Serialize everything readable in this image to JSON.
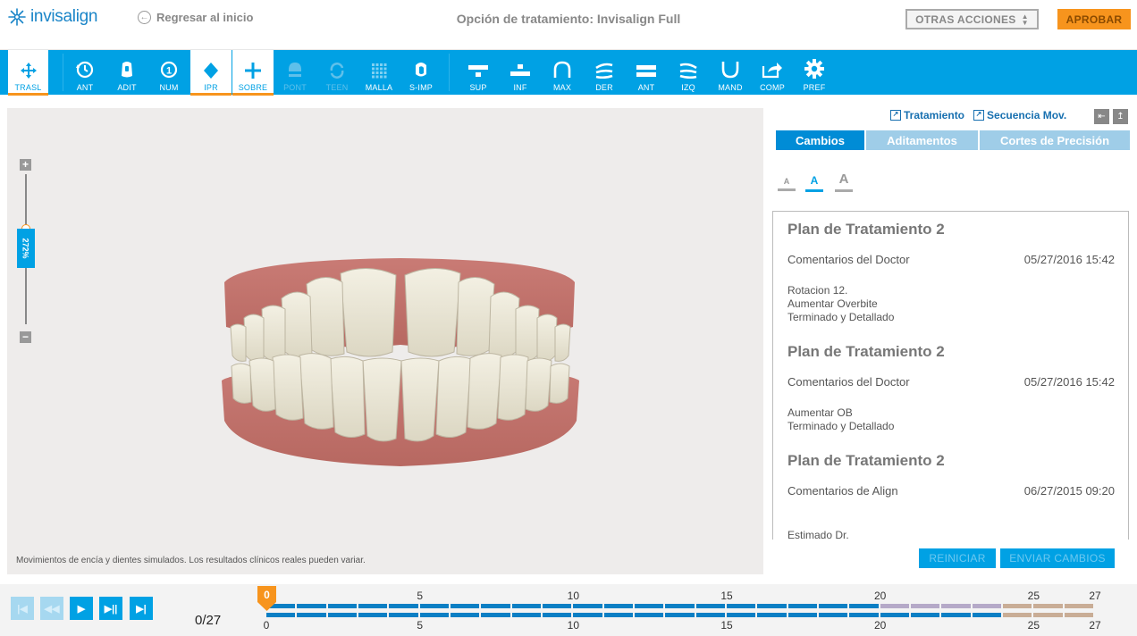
{
  "header": {
    "logo_text": "invisalign",
    "back_label": "Regresar al inicio",
    "title": "Opción de tratamiento: Invisalign Full",
    "other_actions": "OTRAS ACCIONES",
    "approve": "APROBAR"
  },
  "toolbar": {
    "tools": [
      {
        "label": "TRASL",
        "icon": "move-icon"
      },
      {
        "label": "ANT",
        "icon": "history-icon"
      },
      {
        "label": "ADIT",
        "icon": "attachment-icon"
      },
      {
        "label": "NUM",
        "icon": "number-icon"
      },
      {
        "label": "IPR",
        "icon": "diamond-icon"
      },
      {
        "label": "SOBRE",
        "icon": "plus-icon"
      },
      {
        "label": "PONT",
        "icon": "pontic-icon"
      },
      {
        "label": "TEEN",
        "icon": "teen-icon"
      },
      {
        "label": "MALLA",
        "icon": "grid-icon"
      },
      {
        "label": "S-IMP",
        "icon": "superimpose-icon"
      },
      {
        "label": "SUP",
        "icon": "upper-arch-icon"
      },
      {
        "label": "INF",
        "icon": "lower-arch-icon"
      },
      {
        "label": "MAX",
        "icon": "maxillary-icon"
      },
      {
        "label": "DER",
        "icon": "right-view-icon"
      },
      {
        "label": "ANT",
        "icon": "anterior-view-icon"
      },
      {
        "label": "IZQ",
        "icon": "left-view-icon"
      },
      {
        "label": "MAND",
        "icon": "mandibular-icon"
      },
      {
        "label": "COMP",
        "icon": "share-icon"
      },
      {
        "label": "PREF",
        "icon": "gear-icon"
      }
    ]
  },
  "viewport": {
    "zoom_label": "272%",
    "disclaimer": "Movimientos de encía y dientes simulados. Los resultados clínicos reales pueden variar."
  },
  "panel": {
    "link_treatment": "Tratamiento",
    "link_sequence": "Secuencia Mov.",
    "tabs": [
      "Cambios",
      "Aditamentos",
      "Cortes de Precisión"
    ],
    "font_sizes": [
      "A",
      "A",
      "A"
    ],
    "notes": [
      {
        "title": "Plan de Tratamiento 2",
        "author": "Comentarios del Doctor",
        "date": "05/27/2016 15:42",
        "body": "Rotacion 12.\nAumentar Overbite\nTerminado y Detallado"
      },
      {
        "title": "Plan de Tratamiento 2",
        "author": "Comentarios del Doctor",
        "date": "05/27/2016 15:42",
        "body": "Aumentar OB\nTerminado y Detallado"
      },
      {
        "title": "Plan de Tratamiento 2",
        "author": "Comentarios de Align",
        "date": "06/27/2015 09:20",
        "body": "Estimado Dr."
      }
    ],
    "reset": "REINICIAR",
    "send": "ENVIAR CAMBIOS"
  },
  "player": {
    "stage_count": "0/27",
    "current_stage": "0",
    "ticks": [
      "0",
      "5",
      "10",
      "15",
      "20",
      "25",
      "27"
    ],
    "total_stages": 27,
    "colors": {
      "blue": "#0a7fc4",
      "lavender": "#b5a9c8",
      "tan": "#c9ad96"
    }
  }
}
